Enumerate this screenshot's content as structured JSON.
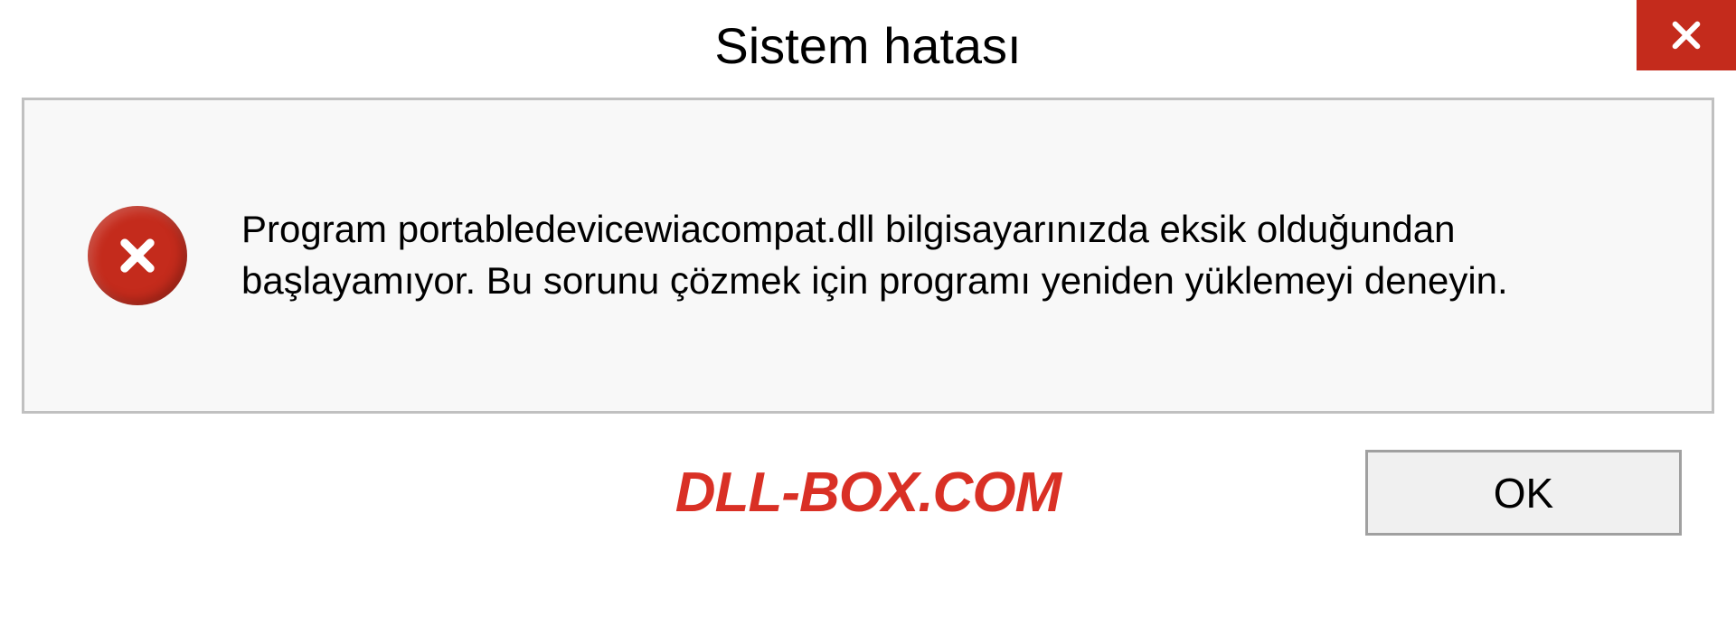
{
  "titlebar": {
    "title": "Sistem hatası"
  },
  "dialog": {
    "message": "Program portabledevicewiacompat.dll bilgisayarınızda eksik olduğundan başlayamıyor. Bu sorunu çözmek için programı yeniden yüklemeyi deneyin."
  },
  "buttons": {
    "ok": "OK"
  },
  "watermark": "DLL-BOX.COM",
  "colors": {
    "error_red": "#c42b1c",
    "watermark_red": "#d93025",
    "border_gray": "#c0c0c0",
    "content_bg": "#f8f8f8"
  }
}
